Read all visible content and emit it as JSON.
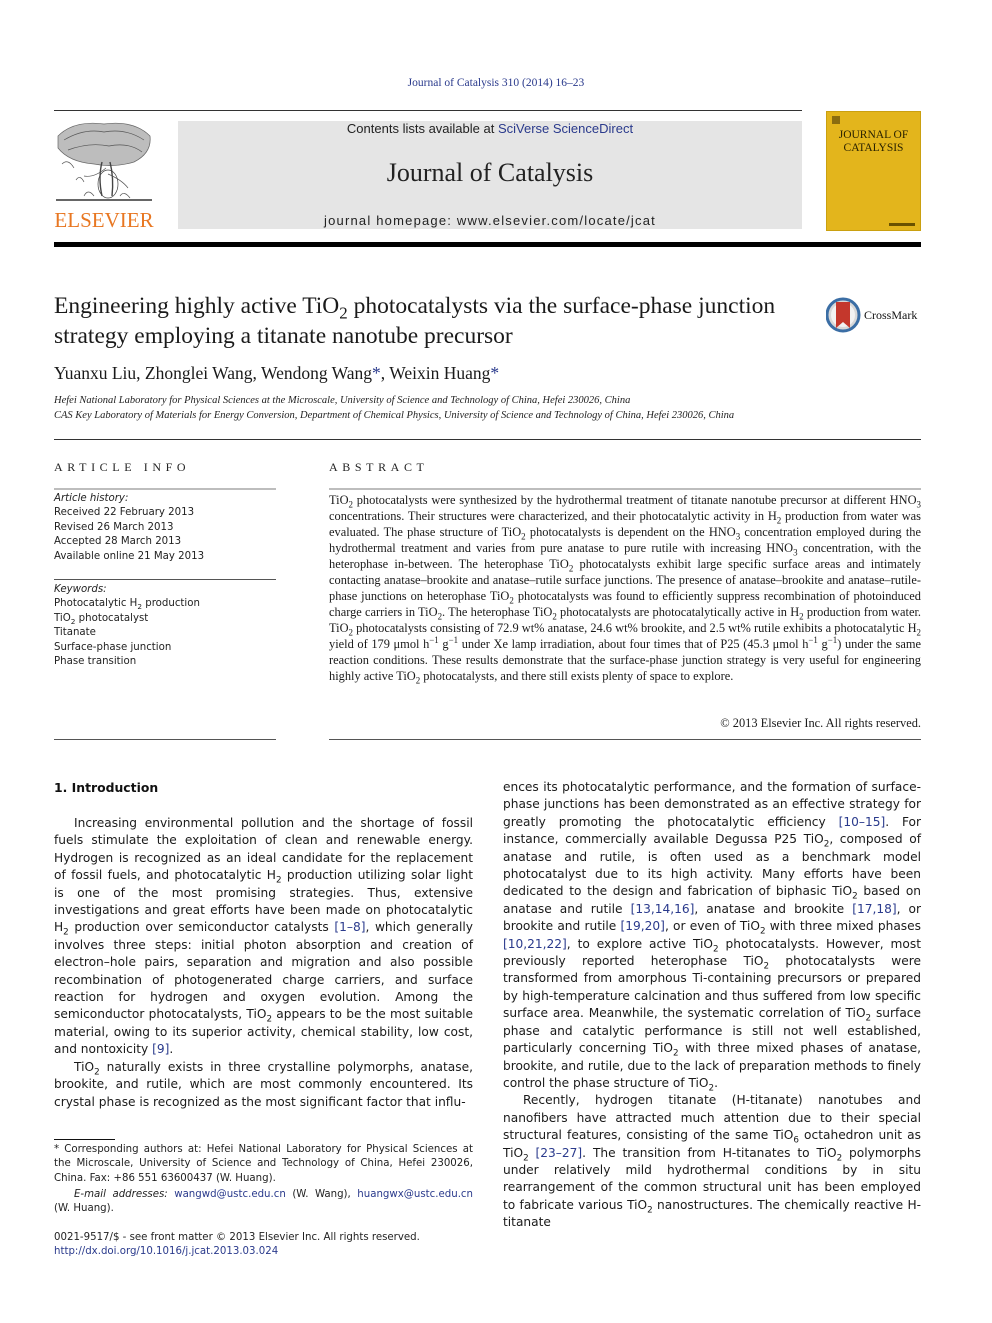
{
  "header": {
    "journal_ref": "Journal of Catalysis 310 (2014) 16–23",
    "contents_prefix": "Contents lists available at ",
    "contents_link": "SciVerse ScienceDirect",
    "journal_title": "Journal of Catalysis",
    "homepage": "journal homepage: www.elsevier.com/locate/jcat",
    "publisher_logo_text": "ELSEVIER",
    "cover_title_line1": "JOURNAL OF",
    "cover_title_line2": "CATALYSIS",
    "crossmark_label": "CrossMark"
  },
  "article": {
    "title_part1": "Engineering highly active TiO",
    "title_sub": "2",
    "title_part2": " photocatalysts via the surface-phase junction strategy employing a titanate nanotube precursor",
    "authors": [
      {
        "name": "Yuanxu Liu",
        "corresponding": false
      },
      {
        "name": "Zhonglei Wang",
        "corresponding": false
      },
      {
        "name": "Wendong Wang",
        "corresponding": true
      },
      {
        "name": "Weixin Huang",
        "corresponding": true
      }
    ],
    "author_sep": ", ",
    "star": "*",
    "affiliations": [
      "Hefei National Laboratory for Physical Sciences at the Microscale, University of Science and Technology of China, Hefei 230026, China",
      "CAS Key Laboratory of Materials for Energy Conversion, Department of Chemical Physics, University of Science and Technology of China, Hefei 230026, China"
    ]
  },
  "article_info": {
    "heading": "ARTICLE INFO",
    "history_label": "Article history:",
    "history": [
      "Received 22 February 2013",
      "Revised 26 March 2013",
      "Accepted 28 March 2013",
      "Available online 21 May 2013"
    ],
    "keywords_label": "Keywords:",
    "keywords": [
      {
        "text": "Photocatalytic H",
        "sub": "2",
        "after": " production"
      },
      {
        "text": "TiO",
        "sub": "2",
        "after": " photocatalyst"
      },
      {
        "text": "Titanate",
        "sub": "",
        "after": ""
      },
      {
        "text": "Surface-phase junction",
        "sub": "",
        "after": ""
      },
      {
        "text": "Phase transition",
        "sub": "",
        "after": ""
      }
    ]
  },
  "abstract": {
    "heading": "ABSTRACT",
    "segments": [
      [
        "t",
        "TiO"
      ],
      [
        "sub",
        "2"
      ],
      [
        "t",
        " photocatalysts were synthesized by the hydrothermal treatment of titanate nanotube precursor at different HNO"
      ],
      [
        "sub",
        "3"
      ],
      [
        "t",
        " concentrations. Their structures were characterized, and their photocatalytic activity in H"
      ],
      [
        "sub",
        "2"
      ],
      [
        "t",
        " production from water was evaluated. The phase structure of TiO"
      ],
      [
        "sub",
        "2"
      ],
      [
        "t",
        " photocatalysts is dependent on the HNO"
      ],
      [
        "sub",
        "3"
      ],
      [
        "t",
        " concentration employed during the hydrothermal treatment and varies from pure anatase to pure rutile with increasing HNO"
      ],
      [
        "sub",
        "3"
      ],
      [
        "t",
        " concentration, with the heterophase in-between. The heterophase TiO"
      ],
      [
        "sub",
        "2"
      ],
      [
        "t",
        " photocatalysts exhibit large specific surface areas and intimately contacting anatase–brookite and anatase–rutile surface junctions. The presence of anatase–brookite and anatase–rutile-phase junctions on heterophase TiO"
      ],
      [
        "sub",
        "2"
      ],
      [
        "t",
        " photocatalysts was found to efficiently suppress recombination of photoinduced charge carriers in TiO"
      ],
      [
        "sub",
        "2"
      ],
      [
        "t",
        ". The heterophase TiO"
      ],
      [
        "sub",
        "2"
      ],
      [
        "t",
        " photocatalysts are photocatalytically active in H"
      ],
      [
        "sub",
        "2"
      ],
      [
        "t",
        " production from water. TiO"
      ],
      [
        "sub",
        "2"
      ],
      [
        "t",
        " photocatalysts consisting of 72.9 wt% anatase, 24.6 wt% brookite, and 2.5 wt% rutile exhibits a photocatalytic H"
      ],
      [
        "sub",
        "2"
      ],
      [
        "t",
        " yield of 179 μmol h"
      ],
      [
        "sup",
        "−1"
      ],
      [
        "t",
        " g"
      ],
      [
        "sup",
        "−1"
      ],
      [
        "t",
        " under Xe lamp irradiation, about four times that of P25 (45.3 μmol h"
      ],
      [
        "sup",
        "−1"
      ],
      [
        "t",
        " g"
      ],
      [
        "sup",
        "−1"
      ],
      [
        "t",
        ") under the same reaction conditions. These results demonstrate that the surface-phase junction strategy is very useful for engineering highly active TiO"
      ],
      [
        "sub",
        "2"
      ],
      [
        "t",
        " photocatalysts, and there still exists plenty of space to explore."
      ]
    ],
    "copyright": "© 2013 Elsevier Inc. All rights reserved."
  },
  "introduction": {
    "heading": "1. Introduction",
    "left_paragraphs": [
      [
        [
          "t",
          "Increasing environmental pollution and the shortage of fossil fuels stimulate the exploitation of clean and renewable energy. Hydrogen is recognized as an ideal candidate for the replacement of fossil fuels, and photocatalytic H"
        ],
        [
          "sub",
          "2"
        ],
        [
          "t",
          " production utilizing solar light is one of the most promising strategies. Thus, extensive investigations and great efforts have been made on photocatalytic H"
        ],
        [
          "sub",
          "2"
        ],
        [
          "t",
          " production over semiconductor catalysts "
        ],
        [
          "ref",
          "[1–8]"
        ],
        [
          "t",
          ", which generally involves three steps: initial photon absorption and creation of electron–hole pairs, separation and migration and also possible recombination of photogenerated charge carriers, and surface reaction for hydrogen and oxygen evolution. Among the semiconductor photocatalysts, TiO"
        ],
        [
          "sub",
          "2"
        ],
        [
          "t",
          " appears to be the most suitable material, owing to its superior activity, chemical stability, low cost, and nontoxicity "
        ],
        [
          "ref",
          "[9]"
        ],
        [
          "t",
          "."
        ]
      ],
      [
        [
          "t",
          "TiO"
        ],
        [
          "sub",
          "2"
        ],
        [
          "t",
          " naturally exists in three crystalline polymorphs, anatase, brookite, and rutile, which are most commonly encountered. Its crystal phase is recognized as the most significant factor that influ-"
        ]
      ]
    ],
    "right_paragraphs": [
      {
        "indent": false,
        "segments": [
          [
            "t",
            "ences its photocatalytic performance, and the formation of surface-phase junctions has been demonstrated as an effective strategy for greatly promoting the photocatalytic efficiency "
          ],
          [
            "ref",
            "[10–15]"
          ],
          [
            "t",
            ". For instance, commercially available Degussa P25 TiO"
          ],
          [
            "sub",
            "2"
          ],
          [
            "t",
            ", composed of anatase and rutile, is often used as a benchmark model photocatalyst due to its high activity. Many efforts have been dedicated to the design and fabrication of biphasic TiO"
          ],
          [
            "sub",
            "2"
          ],
          [
            "t",
            " based on anatase and rutile "
          ],
          [
            "ref",
            "[13,14,16]"
          ],
          [
            "t",
            ", anatase and brookite "
          ],
          [
            "ref",
            "[17,18]"
          ],
          [
            "t",
            ", or brookite and rutile "
          ],
          [
            "ref",
            "[19,20]"
          ],
          [
            "t",
            ", or even of TiO"
          ],
          [
            "sub",
            "2"
          ],
          [
            "t",
            " with three mixed phases "
          ],
          [
            "ref",
            "[10,21,22]"
          ],
          [
            "t",
            ", to explore active TiO"
          ],
          [
            "sub",
            "2"
          ],
          [
            "t",
            " photocatalysts. However, most previously reported heterophase TiO"
          ],
          [
            "sub",
            "2"
          ],
          [
            "t",
            " photocatalysts were transformed from amorphous Ti-containing precursors or prepared by high-temperature calcination and thus suffered from low specific surface area. Meanwhile, the systematic correlation of TiO"
          ],
          [
            "sub",
            "2"
          ],
          [
            "t",
            " surface phase and catalytic performance is still not well established, particularly concerning TiO"
          ],
          [
            "sub",
            "2"
          ],
          [
            "t",
            " with three mixed phases of anatase, brookite, and rutile, due to the lack of preparation methods to finely control the phase structure of TiO"
          ],
          [
            "sub",
            "2"
          ],
          [
            "t",
            "."
          ]
        ]
      },
      {
        "indent": true,
        "segments": [
          [
            "t",
            "Recently, hydrogen titanate (H-titanate) nanotubes and nanofibers have attracted much attention due to their special structural features, consisting of the same TiO"
          ],
          [
            "sub",
            "6"
          ],
          [
            "t",
            " octahedron unit as TiO"
          ],
          [
            "sub",
            "2"
          ],
          [
            "t",
            " "
          ],
          [
            "ref",
            "[23–27]"
          ],
          [
            "t",
            ". The transition from H-titanates to TiO"
          ],
          [
            "sub",
            "2"
          ],
          [
            "t",
            " polymorphs under relatively mild hydrothermal conditions by in situ rearrangement of the common structural unit has been employed to fabricate various TiO"
          ],
          [
            "sub",
            "2"
          ],
          [
            "t",
            " nanostructures. The chemically reactive H-titanate"
          ]
        ]
      }
    ]
  },
  "footnotes": {
    "corresponding": "* Corresponding authors at: Hefei National Laboratory for Physical Sciences at the Microscale, University of Science and Technology of China, Hefei 230026, China. Fax: +86 551 63600437 (W. Huang).",
    "email_label": "E-mail addresses:",
    "email_1": "wangwd@ustc.edu.cn",
    "email_1_owner": " (W. Wang), ",
    "email_2": "huangwx@ustc.edu.cn",
    "email_2_owner": " (W. Huang).",
    "issn_line": "0021-9517/$ - see front matter © 2013 Elsevier Inc. All rights reserved.",
    "doi": "http://dx.doi.org/10.1016/j.jcat.2013.03.024"
  },
  "colors": {
    "link": "#2a3a8c",
    "elsevier_orange": "#e87722",
    "cover_yellow": "#e3b51c",
    "masthead_grey": "#e5e5e5"
  }
}
